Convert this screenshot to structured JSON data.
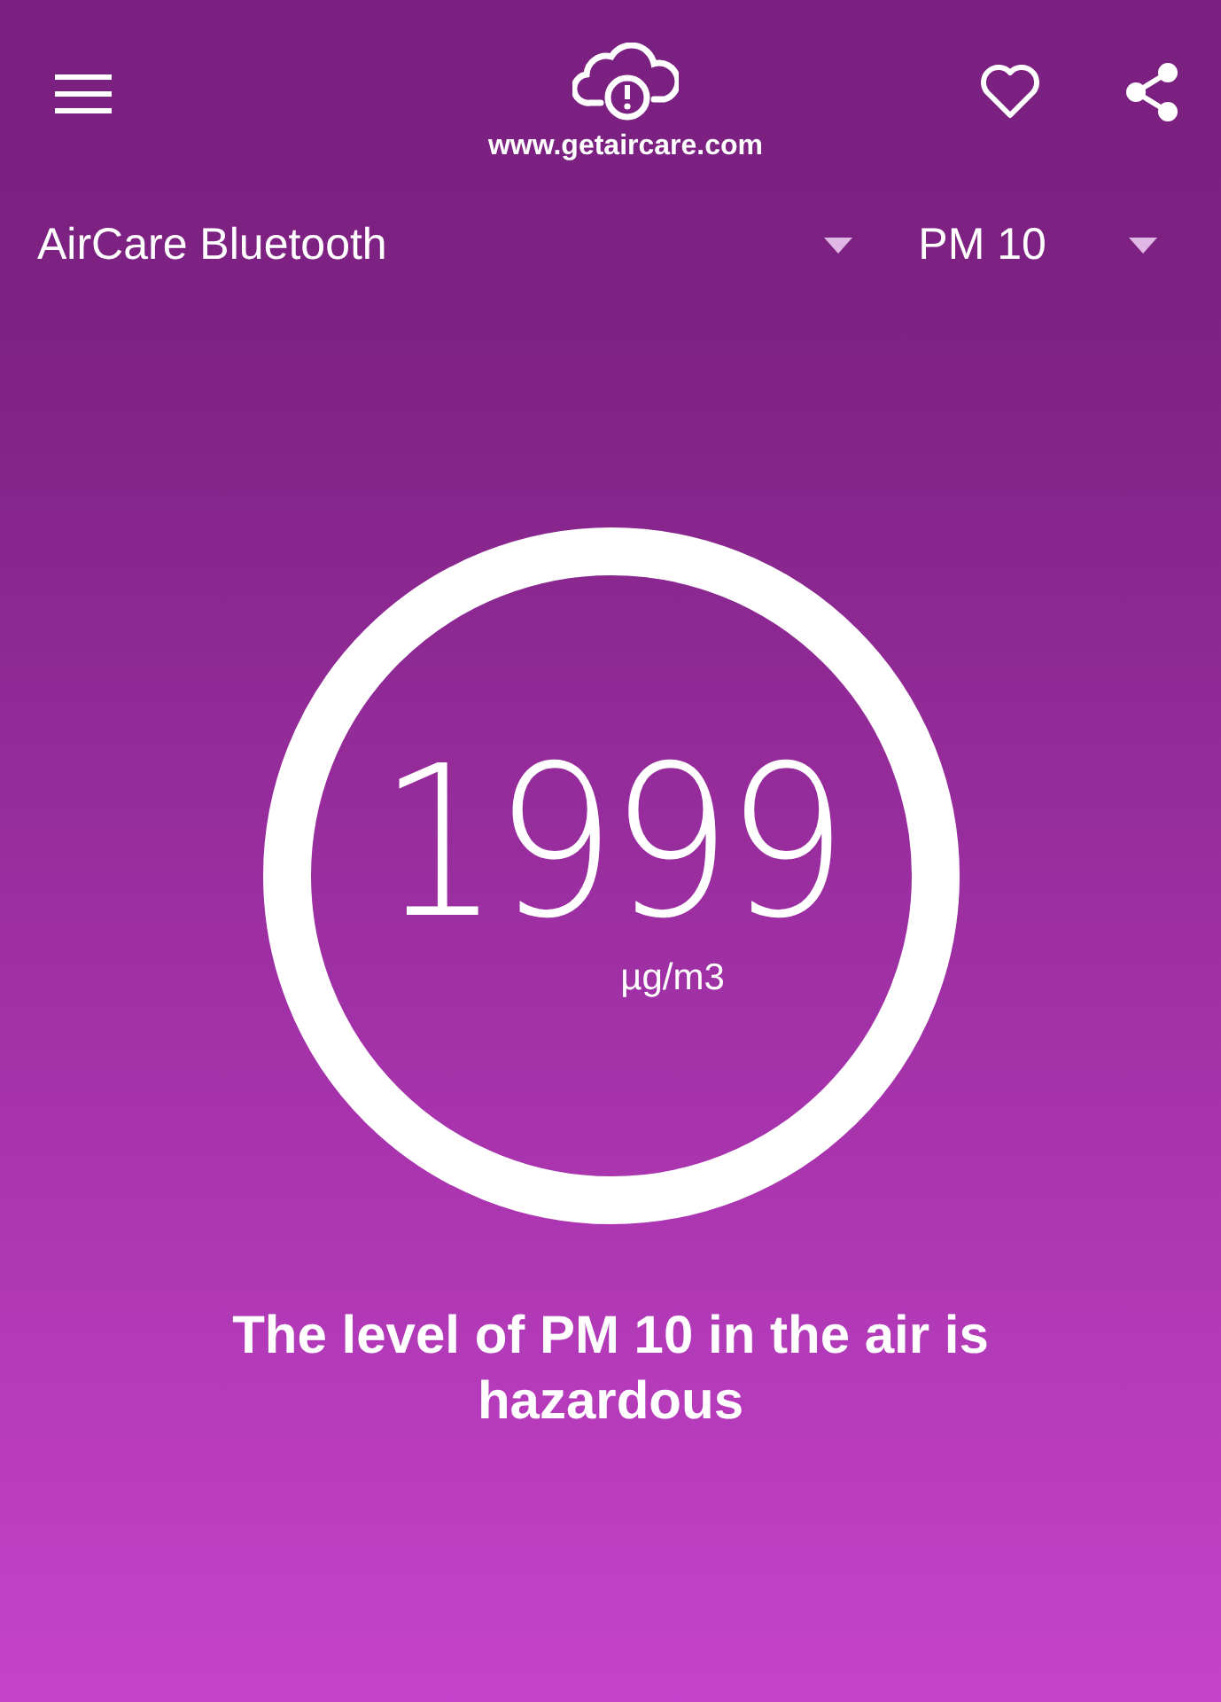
{
  "header": {
    "url": "www.getaircare.com"
  },
  "device_select": {
    "value": "AirCare Bluetooth"
  },
  "pollutant_select": {
    "value": "PM 10"
  },
  "gauge": {
    "level": 1,
    "reading": "1999",
    "unit": "µg/m3"
  },
  "message": "The level of PM 10 in the air is hazardous"
}
